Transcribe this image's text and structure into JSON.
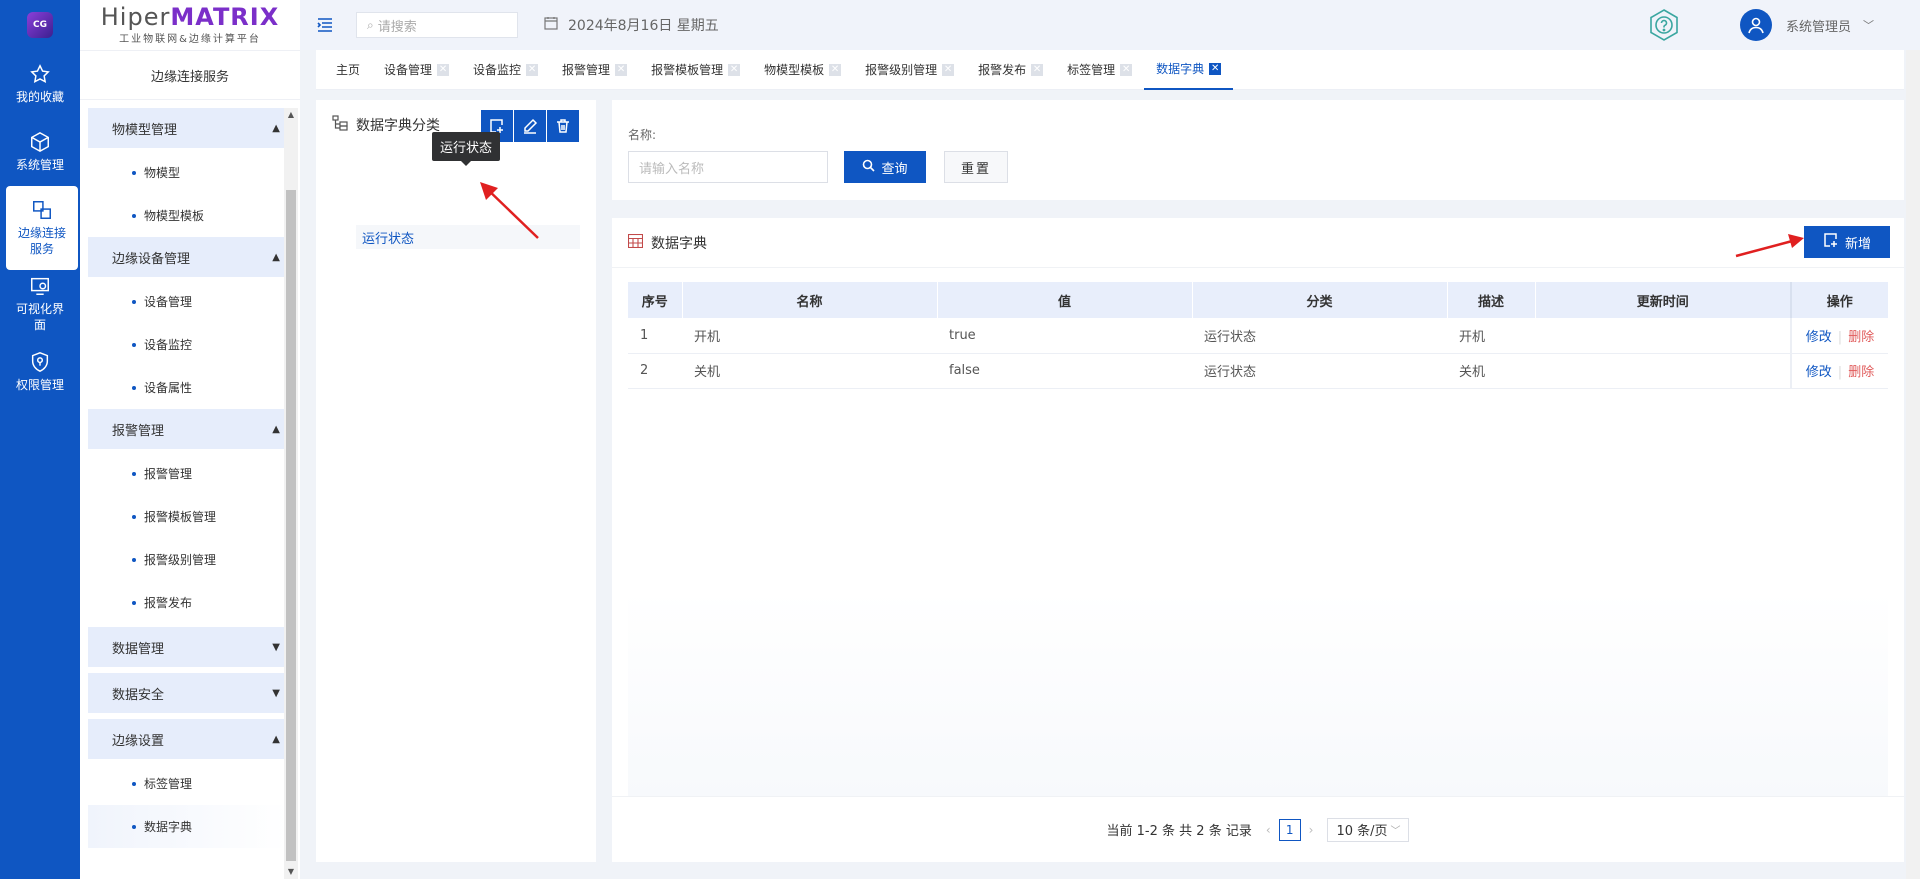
{
  "rail": {
    "logo_text": "CG",
    "items": [
      {
        "label": "我的收藏",
        "icon": "star-icon"
      },
      {
        "label": "系统管理",
        "icon": "cube-icon"
      },
      {
        "label": "边缘连接服务",
        "label_lines": [
          "边缘连接",
          "服务"
        ],
        "icon": "link-icon"
      },
      {
        "label": "可视化界面",
        "label_lines": [
          "可视化界",
          "面"
        ],
        "icon": "monitor-icon"
      },
      {
        "label": "权限管理",
        "icon": "shield-icon"
      }
    ]
  },
  "brand": {
    "prefix": "Hiper",
    "suffix": "MATRIX",
    "subtitle": "工业物联网&边缘计算平台"
  },
  "sidebar": {
    "title": "边缘连接服务",
    "sections": [
      {
        "label": "物模型管理",
        "expanded": true,
        "items": [
          "物模型",
          "物模型模板"
        ]
      },
      {
        "label": "边缘设备管理",
        "expanded": true,
        "items": [
          "设备管理",
          "设备监控",
          "设备属性"
        ]
      },
      {
        "label": "报警管理",
        "expanded": true,
        "items": [
          "报警管理",
          "报警模板管理",
          "报警级别管理",
          "报警发布"
        ]
      },
      {
        "label": "数据管理",
        "expanded": false,
        "items": []
      },
      {
        "label": "数据安全",
        "expanded": false,
        "items": []
      },
      {
        "label": "边缘设置",
        "expanded": true,
        "items": [
          "标签管理",
          "数据字典"
        ]
      }
    ],
    "active_item": "数据字典"
  },
  "header": {
    "search_placeholder": "请搜索",
    "date": "2024年8月16日 星期五",
    "username": "系统管理员"
  },
  "tabs": [
    {
      "label": "主页",
      "closable": false
    },
    {
      "label": "设备管理",
      "closable": true
    },
    {
      "label": "设备监控",
      "closable": true
    },
    {
      "label": "报警管理",
      "closable": true
    },
    {
      "label": "报警模板管理",
      "closable": true
    },
    {
      "label": "物模型模板",
      "closable": true
    },
    {
      "label": "报警级别管理",
      "closable": true
    },
    {
      "label": "报警发布",
      "closable": true
    },
    {
      "label": "标签管理",
      "closable": true
    },
    {
      "label": "数据字典",
      "closable": true,
      "active": true
    }
  ],
  "category_panel": {
    "title": "数据字典分类",
    "tooltip": "运行状态",
    "tree": [
      {
        "label": "运行状态",
        "selected": true
      }
    ]
  },
  "query": {
    "name_label": "名称:",
    "name_placeholder": "请输入名称",
    "search_button": "查询",
    "reset_button": "重置"
  },
  "table_panel": {
    "title": "数据字典",
    "add_button": "新增",
    "columns": [
      "序号",
      "名称",
      "值",
      "分类",
      "描述",
      "更新时间",
      "操作"
    ],
    "rows": [
      {
        "index": "1",
        "name": "开机",
        "value": "true",
        "category": "运行状态",
        "desc": "开机",
        "updated": ""
      },
      {
        "index": "2",
        "name": "关机",
        "value": "false",
        "category": "运行状态",
        "desc": "关机",
        "updated": ""
      }
    ],
    "row_actions": {
      "edit": "修改",
      "separator": "|",
      "delete": "删除"
    }
  },
  "pagination": {
    "summary": "当前 1-2 条 共 2 条 记录",
    "current_page": "1",
    "page_size": "10 条/页"
  },
  "colors": {
    "primary": "#0f56c2",
    "danger": "#e05a5a",
    "brand_accent": "#7b2fc9",
    "annotation_arrow": "#e02020"
  }
}
